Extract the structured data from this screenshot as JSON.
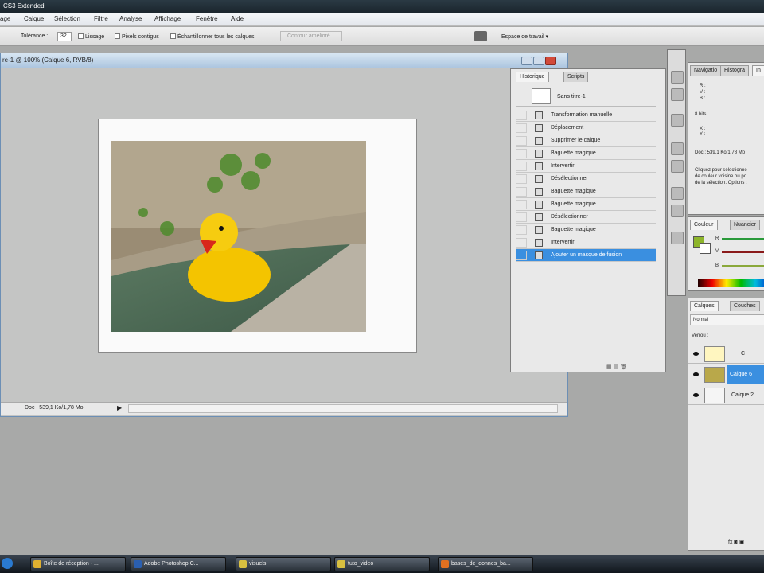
{
  "app": {
    "title": "CS3 Extended"
  },
  "menu": [
    "age",
    "Calque",
    "Sélection",
    "Filtre",
    "Analyse",
    "Affichage",
    "Fenêtre",
    "Aide"
  ],
  "options": {
    "tolerance_label": "Tolérance :",
    "tolerance_value": "32",
    "lissage": "Lissage",
    "pixels_contigus": "Pixels contigus",
    "echantillonner": "Échantillonner tous les calques",
    "contour": "Contour amélioré...",
    "workspace": "Espace de travail ▾"
  },
  "document": {
    "title": "re-1 @ 100% (Calque 6, RVB/8)",
    "status": "Doc : 539,1 Ko/1,78 Mo"
  },
  "history": {
    "tabs": [
      "Historique",
      "Scripts"
    ],
    "snapshot": "Sans titre-1",
    "items": [
      "Transformation manuelle",
      "Déplacement",
      "Supprimer le calque",
      "Baguette magique",
      "Intervertir",
      "Désélectionner",
      "Baguette magique",
      "Baguette magique",
      "Désélectionner",
      "Baguette magique",
      "Intervertir",
      "Ajouter un masque de fusion"
    ],
    "selected_index": 11
  },
  "info": {
    "tabs": [
      "Navigatio",
      "Histogra",
      "In"
    ],
    "rgb": [
      "R :",
      "V :",
      "B :"
    ],
    "bits": "8 bits",
    "xy": [
      "X :",
      "Y :"
    ],
    "doc": "Doc : 539,1 Ko/1,78 Mo",
    "help": [
      "Cliquez pour sélectionne",
      "de couleur voisine ou po",
      "de la sélection. Options :"
    ]
  },
  "color": {
    "tabs": [
      "Couleur",
      "Nuancier"
    ],
    "labels": [
      "R",
      "V",
      "B"
    ],
    "foreground": "#8db52a"
  },
  "layers": {
    "tabs": [
      "Calques",
      "Couches"
    ],
    "blend": "Normal",
    "lock": "Verrou :",
    "items": [
      {
        "name": "C"
      },
      {
        "name": "Calque 6",
        "selected": true
      },
      {
        "name": "Calque 2"
      }
    ]
  },
  "taskbar": [
    {
      "label": "Boîte de réception - ...",
      "color": "#e0b030"
    },
    {
      "label": "Adobe Photoshop C...",
      "color": "#2a5fb0"
    },
    {
      "label": "visuels",
      "color": "#d8c040"
    },
    {
      "label": "tuto_video",
      "color": "#d8c040"
    },
    {
      "label": "bases_de_donnes_ba...",
      "color": "#e07020"
    }
  ]
}
